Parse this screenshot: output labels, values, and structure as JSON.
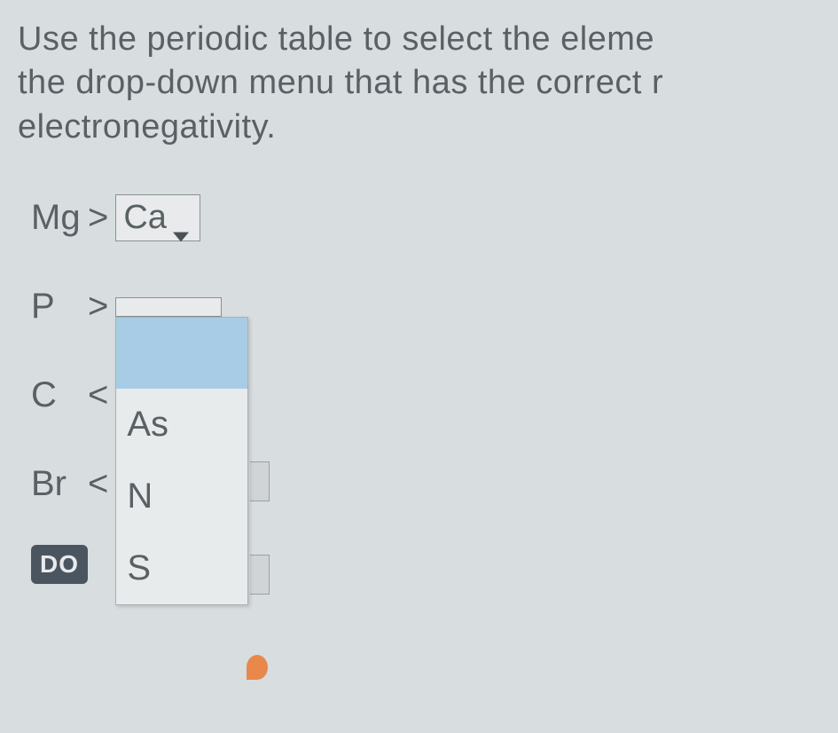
{
  "instruction": {
    "line1": "Use the periodic table to select the eleme",
    "line2": "the drop-down menu that has the correct r",
    "line3": "electronegativity."
  },
  "rows": {
    "r1": {
      "element": "Mg",
      "operator": ">",
      "selected": "Ca"
    },
    "r2": {
      "element": "P",
      "operator": ">",
      "selected": "",
      "options": [
        "",
        "As",
        "N",
        "S"
      ]
    },
    "r3": {
      "element": "C",
      "operator": "<"
    },
    "r4": {
      "element": "Br",
      "operator": "<"
    }
  },
  "badge": "DO"
}
